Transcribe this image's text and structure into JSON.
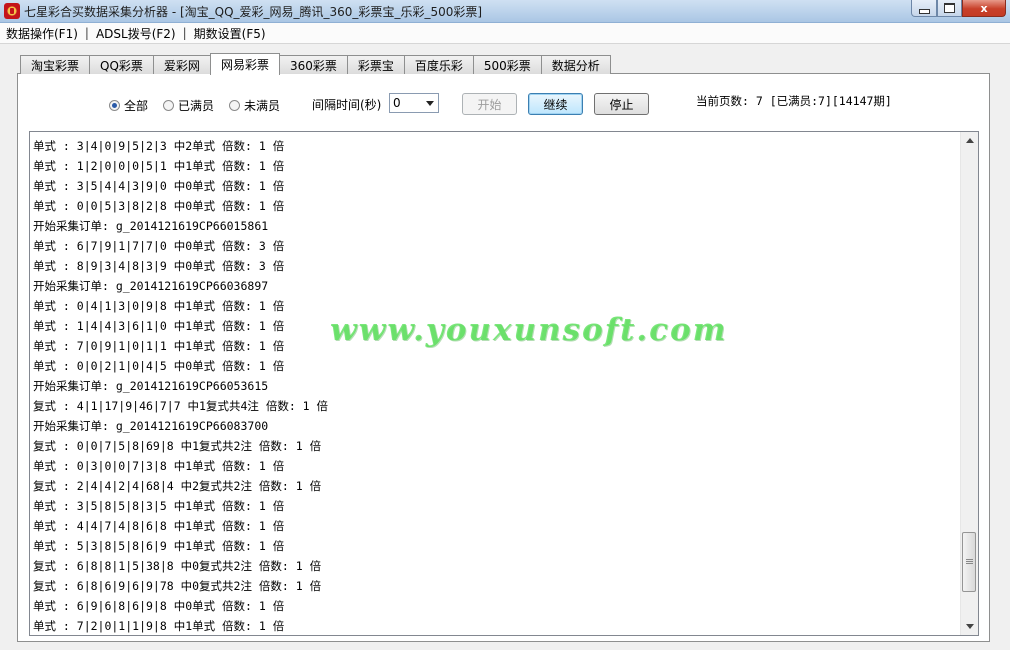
{
  "window": {
    "title": "七星彩合买数据采集分析器 - [淘宝_QQ_爱彩_网易_腾讯_360_彩票宝_乐彩_500彩票]",
    "controls": {
      "minimize": "",
      "maximize": "",
      "close": "x"
    }
  },
  "menu": [
    {
      "label": "数据操作(F1)"
    },
    {
      "label": "ADSL拨号(F2)"
    },
    {
      "label": "期数设置(F5)"
    }
  ],
  "menu_separator": "|",
  "tabs": [
    {
      "label": "淘宝彩票"
    },
    {
      "label": "QQ彩票"
    },
    {
      "label": "爱彩网"
    },
    {
      "label": "网易彩票"
    },
    {
      "label": "360彩票"
    },
    {
      "label": "彩票宝"
    },
    {
      "label": "百度乐彩"
    },
    {
      "label": "500彩票"
    },
    {
      "label": "数据分析"
    }
  ],
  "active_tab": "网易彩票",
  "filter": {
    "options": [
      {
        "label": "全部",
        "selected": true
      },
      {
        "label": "已满员",
        "selected": false
      },
      {
        "label": "未满员",
        "selected": false
      }
    ]
  },
  "interval": {
    "label": "间隔时间(秒)",
    "value": "0"
  },
  "buttons": {
    "start": "开始",
    "continue": "继续",
    "stop": "停止"
  },
  "status": "当前页数: 7 [已满员:7][14147期]",
  "log_lines": [
    "单式 : 3|4|0|9|5|2|3 中2单式 倍数: 1 倍",
    "单式 : 1|2|0|0|0|5|1 中1单式 倍数: 1 倍",
    "单式 : 3|5|4|4|3|9|0 中0单式 倍数: 1 倍",
    "单式 : 0|0|5|3|8|2|8 中0单式 倍数: 1 倍",
    "开始采集订单: g_2014121619CP66015861",
    "单式 : 6|7|9|1|7|7|0 中0单式 倍数: 3 倍",
    "单式 : 8|9|3|4|8|3|9 中0单式 倍数: 3 倍",
    "开始采集订单: g_2014121619CP66036897",
    "单式 : 0|4|1|3|0|9|8 中1单式 倍数: 1 倍",
    "单式 : 1|4|4|3|6|1|0 中1单式 倍数: 1 倍",
    "单式 : 7|0|9|1|0|1|1 中1单式 倍数: 1 倍",
    "单式 : 0|0|2|1|0|4|5 中0单式 倍数: 1 倍",
    "开始采集订单: g_2014121619CP66053615",
    "复式 : 4|1|17|9|46|7|7 中1复式共4注 倍数: 1 倍",
    "开始采集订单: g_2014121619CP66083700",
    "复式 : 0|0|7|5|8|69|8 中1复式共2注 倍数: 1 倍",
    "单式 : 0|3|0|0|7|3|8 中1单式 倍数: 1 倍",
    "复式 : 2|4|4|2|4|68|4 中2复式共2注 倍数: 1 倍",
    "单式 : 3|5|8|5|8|3|5 中1单式 倍数: 1 倍",
    "单式 : 4|4|7|4|8|6|8 中1单式 倍数: 1 倍",
    "单式 : 5|3|8|5|8|6|9 中1单式 倍数: 1 倍",
    "复式 : 6|8|8|1|5|38|8 中0复式共2注 倍数: 1 倍",
    "复式 : 6|8|6|9|6|9|78 中0复式共2注 倍数: 1 倍",
    "单式 : 6|9|6|8|6|9|8 中0单式 倍数: 1 倍",
    "单式 : 7|2|0|1|1|9|8 中1单式 倍数: 1 倍"
  ],
  "watermark": "www.youxunsoft.com"
}
